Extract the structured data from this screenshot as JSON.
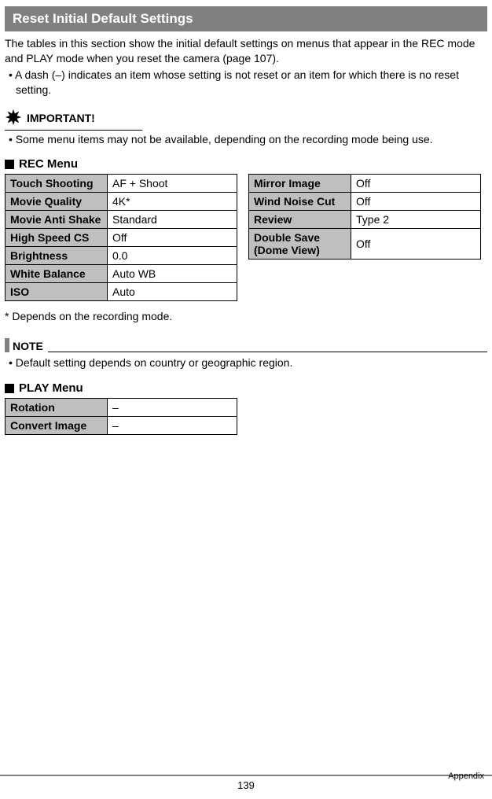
{
  "header": {
    "title": "Reset Initial Default Settings"
  },
  "intro": {
    "p1": "The tables in this section show the initial default settings on menus that appear in the REC mode and PLAY mode when you reset the camera (page 107).",
    "bullet": "• A dash (–) indicates an item whose setting is not reset or an item for which there is no reset setting."
  },
  "important": {
    "label": "IMPORTANT!",
    "bullet": "• Some menu items may not be available, depending on the recording mode being use."
  },
  "rec": {
    "title": "REC Menu",
    "left": [
      {
        "label": "Touch Shooting",
        "value": "AF + Shoot"
      },
      {
        "label": "Movie Quality",
        "value": "4K*"
      },
      {
        "label": "Movie Anti Shake",
        "value": "Standard"
      },
      {
        "label": "High Speed CS",
        "value": "Off"
      },
      {
        "label": "Brightness",
        "value": "0.0"
      },
      {
        "label": "White Balance",
        "value": "Auto WB"
      },
      {
        "label": "ISO",
        "value": "Auto"
      }
    ],
    "right": [
      {
        "label": "Mirror Image",
        "value": "Off"
      },
      {
        "label": "Wind Noise Cut",
        "value": "Off"
      },
      {
        "label": "Review",
        "value": "Type 2"
      },
      {
        "label": "Double Save (Dome View)",
        "value": "Off"
      }
    ],
    "footnote": "* Depends on the recording mode."
  },
  "note": {
    "label": "NOTE",
    "bullet": "• Default setting depends on country or geographic region."
  },
  "play": {
    "title": "PLAY Menu",
    "rows": [
      {
        "label": "Rotation",
        "value": "–"
      },
      {
        "label": "Convert Image",
        "value": "–"
      }
    ]
  },
  "footer": {
    "page": "139",
    "section": "Appendix"
  }
}
